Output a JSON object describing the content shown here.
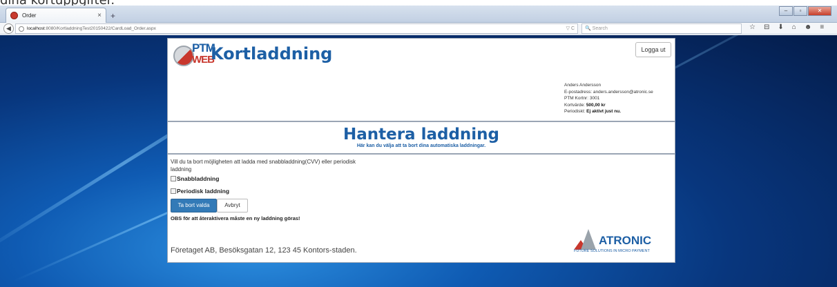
{
  "top_caption": "dina kortuppgifter.",
  "browser": {
    "tab_title": "Order",
    "tab_close": "×",
    "new_tab": "+",
    "url_host": "localhost",
    "url_path": ":8080/KortladdningTest20150422/CardLoad_Order.aspx",
    "url_right": "▽ C",
    "search_placeholder": "Search",
    "win_minimize": "–",
    "win_maximize": "▫",
    "win_close": "✕",
    "toolbar_icons": [
      "☆",
      "⊟",
      "⬇",
      "⌂",
      "☻",
      "≡"
    ]
  },
  "header": {
    "logo_ptm": "PTM",
    "logo_web": "WEB",
    "brand_title": "Kortladdning",
    "logout_label": "Logga ut",
    "user": {
      "name": "Anders Andersson",
      "email_line": "E-postadress: anders.andersson@atronic.se",
      "cardnr_line": "PTM Kortnr: 3001",
      "value_label": "Kortvärde:",
      "value": "500,00 kr",
      "periodic_label": "Periodiskt:",
      "periodic_value": "Ej aktivt just nu."
    }
  },
  "title": {
    "heading": "Hantera laddning",
    "subheading": "Här kan du välja att ta bort dina automatiska laddningar."
  },
  "content": {
    "question": "Vill du ta bort möjligheten att ladda med snabbladdning(CVV) eller periodisk laddning",
    "checkbox_quick": "Snabbladdning",
    "checkbox_periodic": "Periodisk laddning",
    "remove_button": "Ta bort valda",
    "cancel_button": "Avbryt",
    "obs_text": "OBS för att återaktivera måste en ny laddning göras!",
    "footer_address": "Företaget AB, Besöksgatan 12, 123 45 Kontors-staden.",
    "atronic_name": "ATRONIC",
    "atronic_tagline": "FUTURE SOLUTIONS IN MICRO PAYMENT"
  },
  "colors": {
    "brand_blue": "#1d5fa5",
    "brand_red": "#c8372d",
    "primary_button": "#337ab7"
  }
}
